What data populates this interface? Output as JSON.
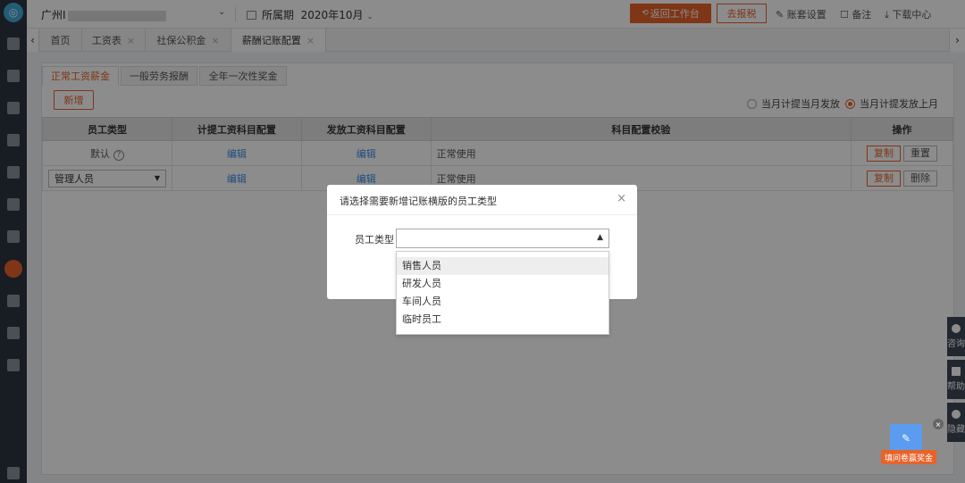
{
  "topbar": {
    "company": "广州I",
    "period_label": "所属期",
    "period_value": "2020年10月",
    "back_button": "返回工作台",
    "tax_button": "去报税",
    "settings_link": "账套设置",
    "notes_link": "备注",
    "download_link": "下载中心"
  },
  "tabs": [
    {
      "label": "首页"
    },
    {
      "label": "工资表"
    },
    {
      "label": "社保公积金"
    },
    {
      "label": "薪酬记账配置"
    }
  ],
  "subtabs": [
    {
      "label": "正常工资薪金"
    },
    {
      "label": "一般劳务报酬"
    },
    {
      "label": "全年一次性奖金"
    }
  ],
  "toolbar": {
    "add_button": "新增",
    "radio_options": [
      {
        "label": "当月计提当月发放",
        "checked": false
      },
      {
        "label": "当月计提发放上月",
        "checked": true
      }
    ]
  },
  "table": {
    "headers": [
      "员工类型",
      "计提工资科目配置",
      "发放工资科目配置",
      "科目配置校验",
      "操作"
    ],
    "rows": [
      {
        "type": "默认",
        "accrual": "编辑",
        "payment": "编辑",
        "check": "正常使用",
        "action1": "复制",
        "action2": "重置"
      },
      {
        "type": "管理人员",
        "accrual": "编辑",
        "payment": "编辑",
        "check": "正常使用",
        "action1": "复制",
        "action2": "删除"
      }
    ]
  },
  "dialog": {
    "title": "请选择需要新增记账横版的员工类型",
    "field_label": "员工类型",
    "options": [
      "销售人员",
      "研发人员",
      "车间人员",
      "临时员工"
    ]
  },
  "float_panel": [
    {
      "label": "咨询"
    },
    {
      "label": "帮助"
    },
    {
      "label": "隐藏"
    }
  ],
  "promo": {
    "label": "填问卷赢奖金"
  },
  "colors": {
    "accent": "#e8632a",
    "link": "#3a8ee6",
    "sidebar": "#2c3440"
  }
}
